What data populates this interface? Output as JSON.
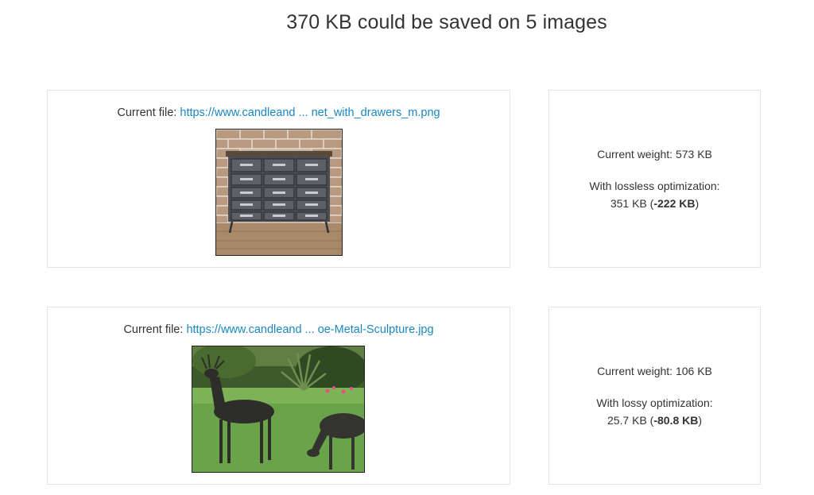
{
  "header": {
    "title": "370 KB could be saved on 5 images"
  },
  "items": [
    {
      "file_prefix": "Current file: ",
      "file_link": "https://www.candleand ... net_with_drawers_m.png",
      "image_icon": "cabinet-image",
      "current_weight": "Current weight: 573 KB",
      "optimization_label": "With lossless optimization:",
      "optimized_size": "351 KB (",
      "savings": "-222 KB",
      "close_paren": ")"
    },
    {
      "file_prefix": "Current file: ",
      "file_link": "https://www.candleand ... oe-Metal-Sculpture.jpg",
      "image_icon": "deer-sculpture-image",
      "current_weight": "Current weight: 106 KB",
      "optimization_label": "With lossy optimization:",
      "optimized_size": "25.7 KB (",
      "savings": "-80.8 KB",
      "close_paren": ")"
    }
  ],
  "colors": {
    "link": "#1a87c0",
    "text": "#333333",
    "border": "#e4e4e4"
  }
}
